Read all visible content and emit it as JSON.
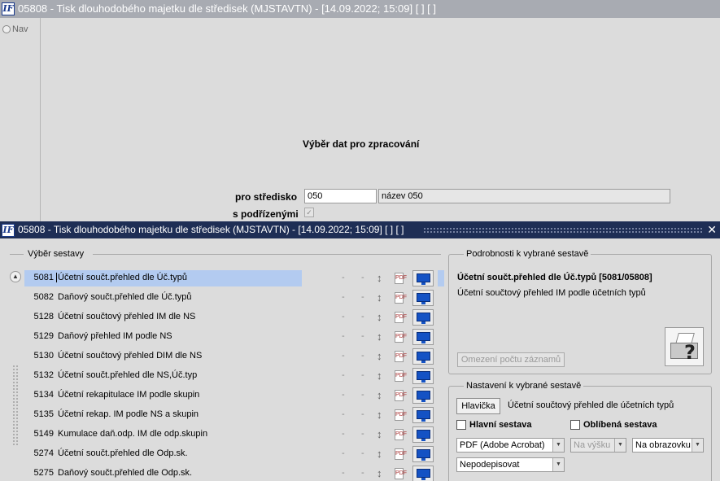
{
  "bg_window": {
    "title": "05808 - Tisk dlouhodobého majetku dle středisek (MJSTAVTN) - [14.09.2022; 15:09]  [ ]  [ ]",
    "nav_label": "Nav",
    "heading": "Výběr dat pro zpracování",
    "stredisko_label": "pro středisko",
    "stredisko_value": "050",
    "stredisko_name": "název 050",
    "podrizenymi_label": "s podřízenými",
    "podrizenymi_mark": "✓"
  },
  "fg_window": {
    "title": "05808 - Tisk dlouhodobého majetku dle středisek (MJSTAVTN) - [14.09.2022; 15:09]  [ ]  [ ]",
    "close": "✕"
  },
  "reports": {
    "group_title": "Výběr sestavy",
    "dash": "-",
    "sort_glyph": "↕",
    "pdf_glyph": "PDF",
    "scroll_up": "▲",
    "rows": [
      {
        "num": "5081",
        "name": "Účetní součt.přehled dle Úč.typů"
      },
      {
        "num": "5082",
        "name": "Daňový součt.přehled dle Úč.typů"
      },
      {
        "num": "5128",
        "name": "Účetní součtový přehled IM dle NS"
      },
      {
        "num": "5129",
        "name": "Daňový přehled IM podle NS"
      },
      {
        "num": "5130",
        "name": "Účetní součtový přehled DIM dle NS"
      },
      {
        "num": "5132",
        "name": "Účetní součt.přehled dle NS,Úč.typ"
      },
      {
        "num": "5134",
        "name": "Účetní rekapitulace IM podle skupin"
      },
      {
        "num": "5135",
        "name": "Účetní rekap. IM podle NS a skupin"
      },
      {
        "num": "5149",
        "name": "Kumulace daň.odp. IM dle odp.skupin"
      },
      {
        "num": "5274",
        "name": "Účetní součt.přehled dle Odp.sk."
      },
      {
        "num": "5275",
        "name": "Daňový součt.přehled dle Odp.sk."
      }
    ]
  },
  "details": {
    "group_title": "Podrobnosti k vybrané sestavě",
    "title": "Účetní součt.přehled dle Úč.typů [5081/05808]",
    "description": "Účetní součtový přehled IM podle účetních typů",
    "limit_button": "Omezení počtu záznamů",
    "help_glyph": "?"
  },
  "settings": {
    "group_title": "Nastavení k vybrané sestavě",
    "header_button": "Hlavička",
    "header_text": "Účetní součtový přehled dle účetních typů",
    "main_report_label": "Hlavní sestava",
    "favorite_label": "Oblíbená sestava",
    "output_format": "PDF (Adobe Acrobat)",
    "orientation": "Na výšku",
    "destination": "Na obrazovku",
    "signature": "Nepodepisovat",
    "arrow": "▼"
  }
}
